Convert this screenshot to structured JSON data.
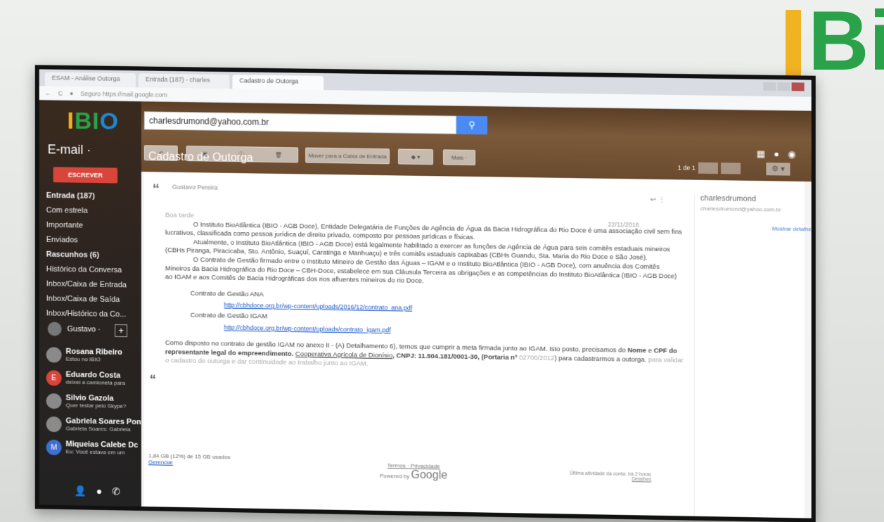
{
  "corner_logo": {
    "text": "Bi"
  },
  "browser": {
    "tabs": [
      "ESAM - Análise Outorga",
      "Entrada (187) - charles",
      "Cadastro de Outorga"
    ],
    "address": "Seguro  https://mail.google.com"
  },
  "sidebar": {
    "logo": {
      "i": "I",
      "b": "BI",
      "o": "O"
    },
    "mail_label": "E-mail ·",
    "compose": "ESCREVER",
    "nav": [
      "Entrada (187)",
      "Com estrela",
      "Importante",
      "Enviados",
      "Rascunhos (6)",
      "Histórico da Conversa",
      "Inbox/Caixa de Entrada",
      "Inbox/Caixa de Saída",
      "Inbox/Histórico da Co..."
    ],
    "user": "Gustavo ·",
    "contacts": [
      {
        "name": "Rosana Ribeiro",
        "status": "Estou no IBIO",
        "initial": ""
      },
      {
        "name": "Eduardo Costa",
        "status": "deixei a camioneta para",
        "initial": "E"
      },
      {
        "name": "Silvio Gazola",
        "status": "Quer testar pelo Skype?",
        "initial": ""
      },
      {
        "name": "Gabriela Soares Pon",
        "status": "Gabriela Soares: Gabriela",
        "initial": ""
      },
      {
        "name": "Miqueias Calebe Dc",
        "status": "Eu: Você estava em um",
        "initial": "M"
      }
    ]
  },
  "header": {
    "search_value": "charlesdrumond@yahoo.com.br",
    "toolbar": {
      "move": "Mover para a Caixa de Entrada",
      "more": "Mais ·"
    }
  },
  "message": {
    "subject": "Cadastro de Outorga",
    "pager": "1 de 1",
    "sender": "Gustavo Pereira",
    "date": "22/11/2016",
    "greeting": "Boa tarde",
    "paragraphs": [
      "O Instituto BioAtlântica (IBIO - AGB Doce), Entidade Delegatária de Funções de Agência de Água da Bacia Hidrográfica do Rio Doce é uma associação civil sem fins lucrativos, classificada como pessoa jurídica de direito privado, composto por pessoas jurídicas e físicas.",
      "Atualmente, o Instituto BioAtlântica (IBIO - AGB Doce) está legalmente habilitado a exercer as funções de Agência de Água para seis comitês estaduais mineiros (CBHs Piranga, Piracicaba, Sto. Antônio, Suaçuí, Caratinga e Manhuaçu) e três comitês estaduais capixabas (CBHs Guandu, Sta. Maria do Rio Doce e São José).",
      "O Contrato de Gestão firmado entre o Instituto Mineiro de Gestão das Águas – IGAM e o Instituto BioAtlântica (IBIO - AGB Doce), com anuência dos Comitês Mineiros da Bacia Hidrográfica do Rio Doce – CBH-Doce, estabelece em sua Cláusula Terceira as obrigações e as competências do Instituto BioAtlântica (IBIO - AGB Doce) ao IGAM e aos Comitês de Bacia Hidrográficas dos rios afluentes mineiros do rio Doce."
    ],
    "contracts": [
      {
        "label": "Contrato de Gestão ANA",
        "link": "http://cbhdoce.org.br/wp-content/uploads/2016/12/contrato_ana.pdf"
      },
      {
        "label": "Contrato de Gestão IGAM",
        "link": "http://cbhdoce.org.br/wp-content/uploads/contrato_igam.pdf"
      }
    ],
    "closing_1": "Como disposto no contrato de gestão IGAM no anexo II - (A) Detalhamento 6), temos que cumprir a meta firmada junto ao IGAM. Isto posto, precisamos do",
    "closing_nome": "Nome",
    "closing_e": "e",
    "closing_cpf": "CPF do representante legal do empreendimento.",
    "closing_coop": "Cooperativa Agrícola de Dionísio",
    "closing_cnpj": ", CNPJ: 11.504.181/0001-30, (Portaria nº",
    "closing_portaria": "02700/2012",
    "closing_end": ") para cadastrarmos a outorga.",
    "closing_faint": "para validar o cadastro de outorga e dar continuidade ao trabalho junto ao IGAM."
  },
  "right_panel": {
    "name": "charlesdrumond",
    "email": "charlesdrumond@yahoo.com.br",
    "details": "Mostrar detalhes"
  },
  "footer": {
    "usage": "1,84 GB (12%) de 15 GB usados",
    "manage": "Gerenciar",
    "terms": "Termos · Privacidade",
    "powered": "Powered by",
    "google": "Google",
    "activity": "Última atividade da conta: há 2 horas",
    "details": "Detalhes"
  }
}
